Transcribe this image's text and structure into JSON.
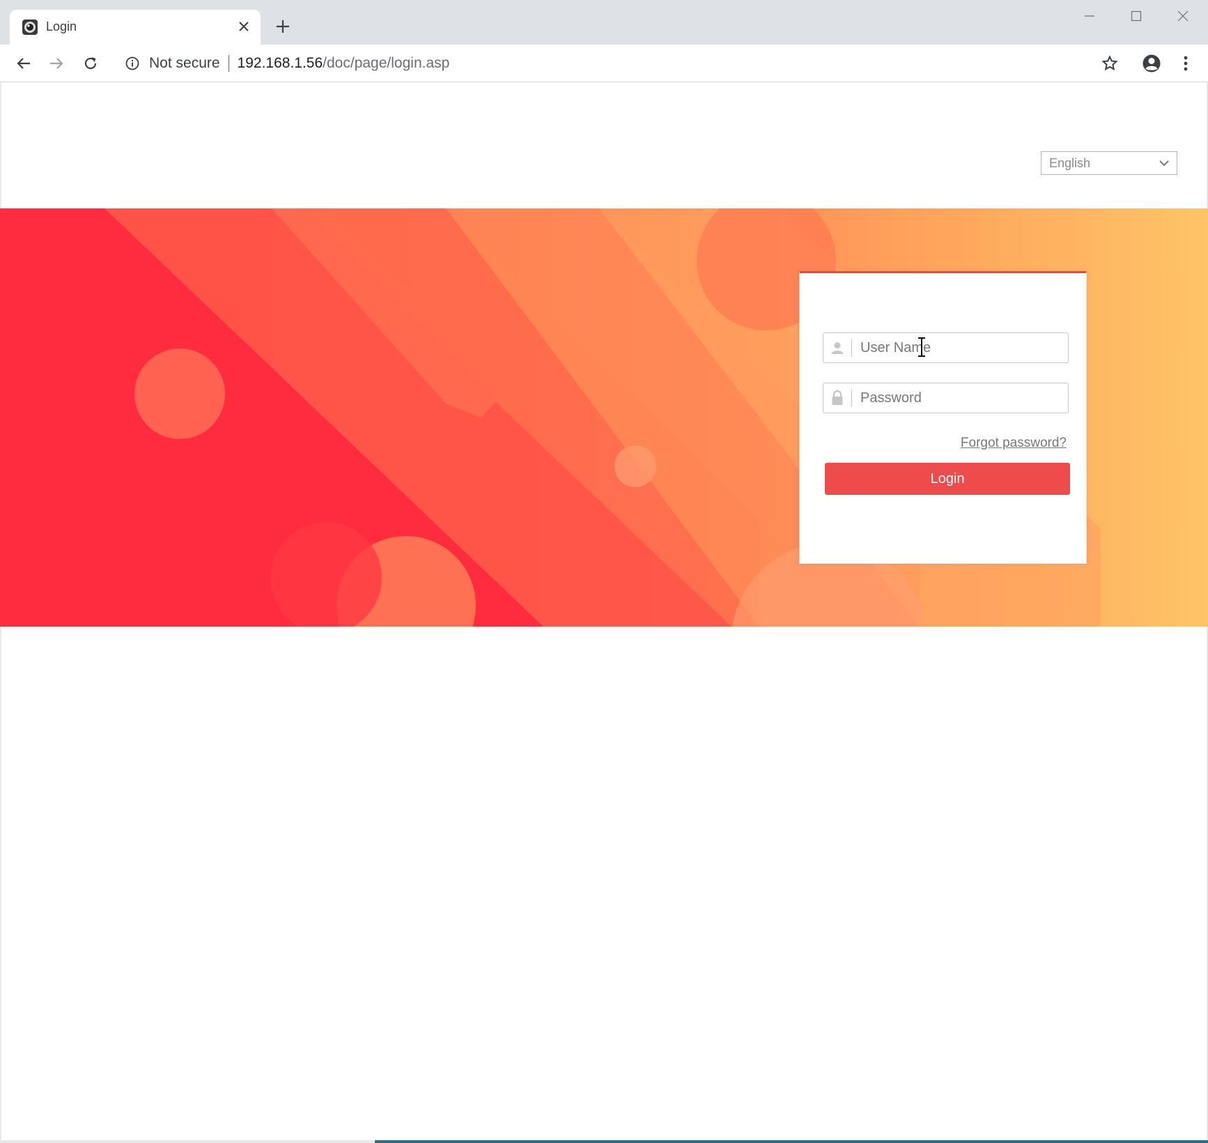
{
  "browser": {
    "tab": {
      "title": "Login",
      "favicon": "camera-lens-icon"
    },
    "omnibox": {
      "security_label": "Not secure",
      "url_host": "192.168.1.56",
      "url_path": "/doc/page/login.asp"
    },
    "icons": {
      "back": "arrow-left-icon",
      "forward": "arrow-right-icon",
      "reload": "reload-icon",
      "info": "info-icon",
      "star": "star-icon",
      "profile": "account-icon",
      "menu": "kebab-menu-icon",
      "new_tab": "plus-icon",
      "close_tab": "close-icon"
    }
  },
  "page": {
    "language_select": {
      "selected": "English"
    },
    "login": {
      "username_placeholder": "User Name",
      "password_placeholder": "Password",
      "forgot_password": "Forgot password?",
      "login_button": "Login"
    }
  },
  "colors": {
    "accent": "#f04b4b",
    "banner_red": "#ff2b3f",
    "banner_orange": "#ff8c55",
    "banner_yellow": "#ffc466"
  }
}
